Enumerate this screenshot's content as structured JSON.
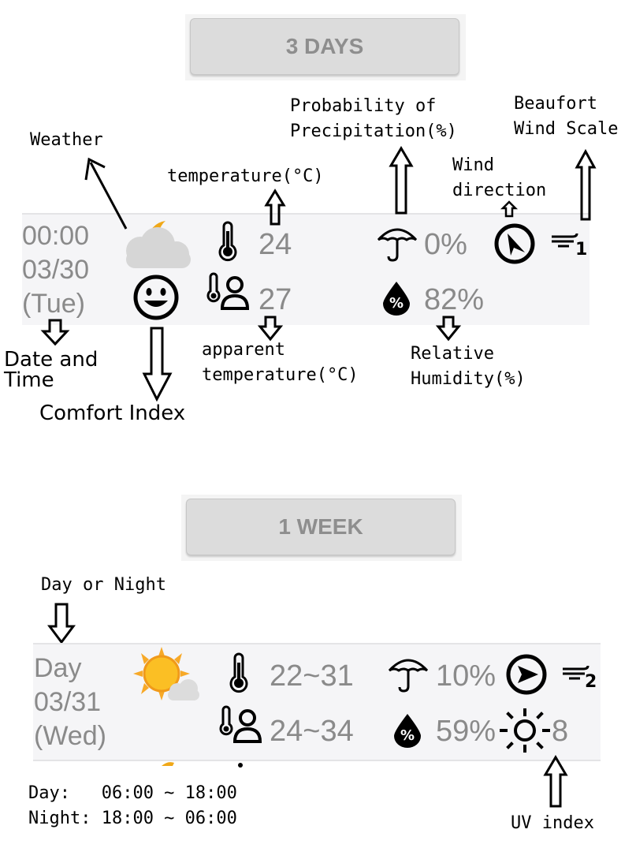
{
  "tabs": {
    "three_days": "3 DAYS",
    "one_week": "1 WEEK"
  },
  "three_days_row": {
    "time": "00:00",
    "date": "03/30",
    "weekday": "(Tue)",
    "temperature": "24",
    "apparent_temperature": "27",
    "precipitation": "0%",
    "humidity": "82%",
    "wind_scale": "1",
    "weather_icon": "partly-cloudy-night-icon",
    "comfort_icon": "smiley-face-icon"
  },
  "week_row": {
    "period": "Day",
    "date": "03/31",
    "weekday": "(Wed)",
    "temperature": "22~31",
    "apparent_temperature": "24~34",
    "precipitation": "10%",
    "humidity": "59%",
    "uv_index": "8",
    "wind_scale": "2",
    "weather_icon": "sunny-partly-cloudy-icon"
  },
  "annotations": {
    "weather": "Weather",
    "temperature": "temperature(°C)",
    "pop_line1": "Probability of",
    "pop_line2": "Precipitation(%)",
    "wind_direction_line1": "Wind",
    "wind_direction_line2": "direction",
    "beaufort_line1": "Beaufort",
    "beaufort_line2": "Wind Scale",
    "date_time_line1": "Date and",
    "date_time_line2": "Time",
    "comfort_index": "Comfort Index",
    "apparent_line1": "apparent",
    "apparent_line2": "temperature(°C)",
    "humidity_line1": "Relative",
    "humidity_line2": "Humidity(%)",
    "day_or_night": "Day or Night",
    "day_hours": "Day:   06:00 ~ 18:00",
    "night_hours": "Night: 18:00 ~ 06:00",
    "uv_index": "UV index"
  },
  "colors": {
    "value_text": "#8a8a8a",
    "tab_bg": "#dcdcdc",
    "row_bg": "#f5f5f7",
    "sun": "#f7a928",
    "moon": "#f0a818",
    "cloud": "#d4d4d4"
  }
}
